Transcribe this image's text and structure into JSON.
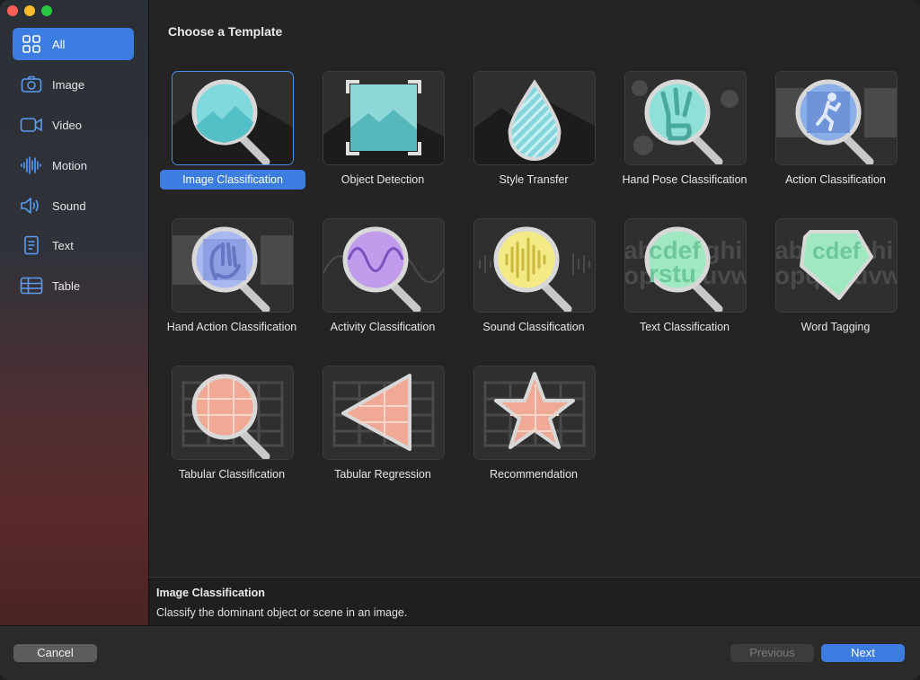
{
  "window": {
    "traffic_lights": {
      "close": "#ff5f57",
      "minimize": "#febc2e",
      "zoom": "#28c840"
    }
  },
  "sidebar": {
    "items": [
      {
        "label": "All",
        "icon": "grid-icon",
        "selected": true
      },
      {
        "label": "Image",
        "icon": "camera-icon",
        "selected": false
      },
      {
        "label": "Video",
        "icon": "video-camera-icon",
        "selected": false
      },
      {
        "label": "Motion",
        "icon": "waveform-icon",
        "selected": false
      },
      {
        "label": "Sound",
        "icon": "speaker-icon",
        "selected": false
      },
      {
        "label": "Text",
        "icon": "document-icon",
        "selected": false
      },
      {
        "label": "Table",
        "icon": "table-icon",
        "selected": false
      }
    ]
  },
  "main": {
    "heading": "Choose a Template",
    "templates": [
      {
        "label": "Image Classification",
        "icon": "magnifier-landscape-icon",
        "selected": true
      },
      {
        "label": "Object Detection",
        "icon": "framed-landscape-icon",
        "selected": false
      },
      {
        "label": "Style Transfer",
        "icon": "striped-droplet-icon",
        "selected": false
      },
      {
        "label": "Hand Pose Classification",
        "icon": "magnifier-peace-hand-icon",
        "selected": false
      },
      {
        "label": "Action Classification",
        "icon": "magnifier-runner-icon",
        "selected": false
      },
      {
        "label": "Hand Action Classification",
        "icon": "magnifier-waving-hand-icon",
        "selected": false
      },
      {
        "label": "Activity Classification",
        "icon": "magnifier-sine-wave-icon",
        "selected": false
      },
      {
        "label": "Sound Classification",
        "icon": "magnifier-audio-wave-icon",
        "selected": false
      },
      {
        "label": "Text Classification",
        "icon": "magnifier-letters-icon",
        "selected": false
      },
      {
        "label": "Word Tagging",
        "icon": "tag-letters-icon",
        "selected": false
      },
      {
        "label": "Tabular Classification",
        "icon": "magnifier-table-icon",
        "selected": false
      },
      {
        "label": "Tabular Regression",
        "icon": "triangle-table-icon",
        "selected": false
      },
      {
        "label": "Recommendation",
        "icon": "star-table-icon",
        "selected": false
      }
    ],
    "tile_text": {
      "letters_line1": "abcdefghi",
      "letters_line2": "opqrstuvw"
    }
  },
  "description": {
    "title": "Image Classification",
    "text": "Classify the dominant object or scene in an image."
  },
  "footer": {
    "cancel_label": "Cancel",
    "previous_label": "Previous",
    "next_label": "Next"
  },
  "colors": {
    "accent": "#3b7de0"
  }
}
